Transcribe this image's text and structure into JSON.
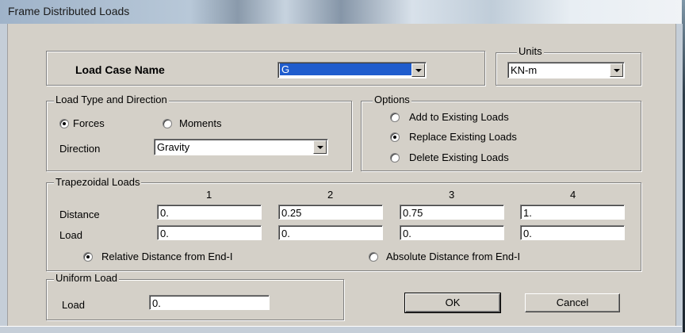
{
  "window": {
    "title": "Frame Distributed Loads"
  },
  "load_case": {
    "label": "Load Case Name",
    "value": "G"
  },
  "units": {
    "label": "Units",
    "value": "KN-m"
  },
  "load_type": {
    "label": "Load Type and Direction",
    "forces_label": "Forces",
    "moments_label": "Moments",
    "selected": "Forces",
    "direction_label": "Direction",
    "direction_value": "Gravity"
  },
  "options": {
    "label": "Options",
    "items": [
      "Add to Existing Loads",
      "Replace Existing Loads",
      "Delete Existing Loads"
    ],
    "selected": "Replace Existing Loads"
  },
  "trapezoidal": {
    "label": "Trapezoidal Loads",
    "columns": [
      "1",
      "2",
      "3",
      "4"
    ],
    "distance_label": "Distance",
    "load_label": "Load",
    "distance": [
      "0.",
      "0.25",
      "0.75",
      "1."
    ],
    "load": [
      "0.",
      "0.",
      "0.",
      "0."
    ],
    "relative_label": "Relative Distance from End-I",
    "absolute_label": "Absolute Distance from End-I",
    "selected": "Relative Distance from End-I"
  },
  "uniform": {
    "label": "Uniform Load",
    "load_label": "Load",
    "value": "0."
  },
  "buttons": {
    "ok": "OK",
    "cancel": "Cancel"
  }
}
